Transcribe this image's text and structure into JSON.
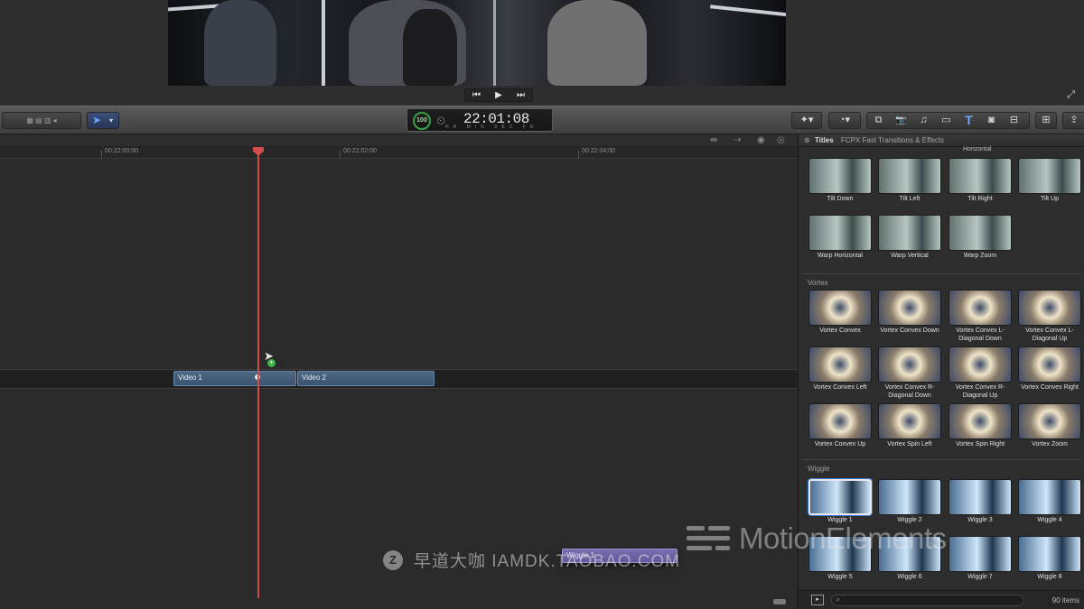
{
  "transport": {
    "prev": "⏮",
    "play": "▶",
    "next": "⏭"
  },
  "toolbar": {
    "left_group": "▦ ▤ ▥ ◂",
    "tool_arrow": "➤",
    "tool_caret": "▾",
    "timecode": "22:01:08",
    "timecode_badge": "100",
    "timecode_sub": "HR MIN SEC FR",
    "right_icons": [
      "✦▾",
      "◔▾",
      "⧉",
      "📷",
      "♫",
      "▭",
      "T",
      "◙",
      "⊟",
      "⊞",
      "⇪"
    ]
  },
  "ruler": {
    "labels": [
      "00:22:00:00",
      "00:22:02:00",
      "00:22:04:00"
    ]
  },
  "timeline": {
    "clips": [
      {
        "name": "Video 1"
      },
      {
        "name": "Video 2"
      },
      {
        "name": "Wiggle 1"
      }
    ]
  },
  "browser": {
    "header_title": "Titles",
    "header_subtitle": "FCPX Fast Transitions & Effects",
    "cut_label": "Horizontal",
    "sections": [
      {
        "title": "",
        "items": [
          "Tilt Down",
          "Tilt Left",
          "Tilt Right",
          "Tilt Up",
          "Warp Horizontal",
          "Warp Vertical",
          "Warp Zoom"
        ]
      },
      {
        "title": "Vortex",
        "items": [
          "Vortex Convex",
          "Vortex Convex Down",
          "Vortex Convex L-Diagonal Down",
          "Vortex Convex L-Diagonal Up",
          "Vortex Convex Left",
          "Vortex Convex R-Diagonal Down",
          "Vortex Convex R-Diagonal Up",
          "Vortex Convex Right",
          "Vortex Convex Up",
          "Vortex Spin Left",
          "Vortex Spin Right",
          "Vortex Zoom"
        ]
      },
      {
        "title": "Wiggle",
        "items": [
          "Wiggle 1",
          "Wiggle 2",
          "Wiggle 3",
          "Wiggle 4",
          "Wiggle 5",
          "Wiggle 6",
          "Wiggle 7",
          "Wiggle 8"
        ]
      }
    ],
    "item_count": "90 items",
    "search_icon": "⌕"
  },
  "watermarks": {
    "taobao_logo": "Z",
    "taobao_text": "早道大咖  IAMDK.TAOBAO.COM",
    "motion_text": "MotionElements"
  }
}
